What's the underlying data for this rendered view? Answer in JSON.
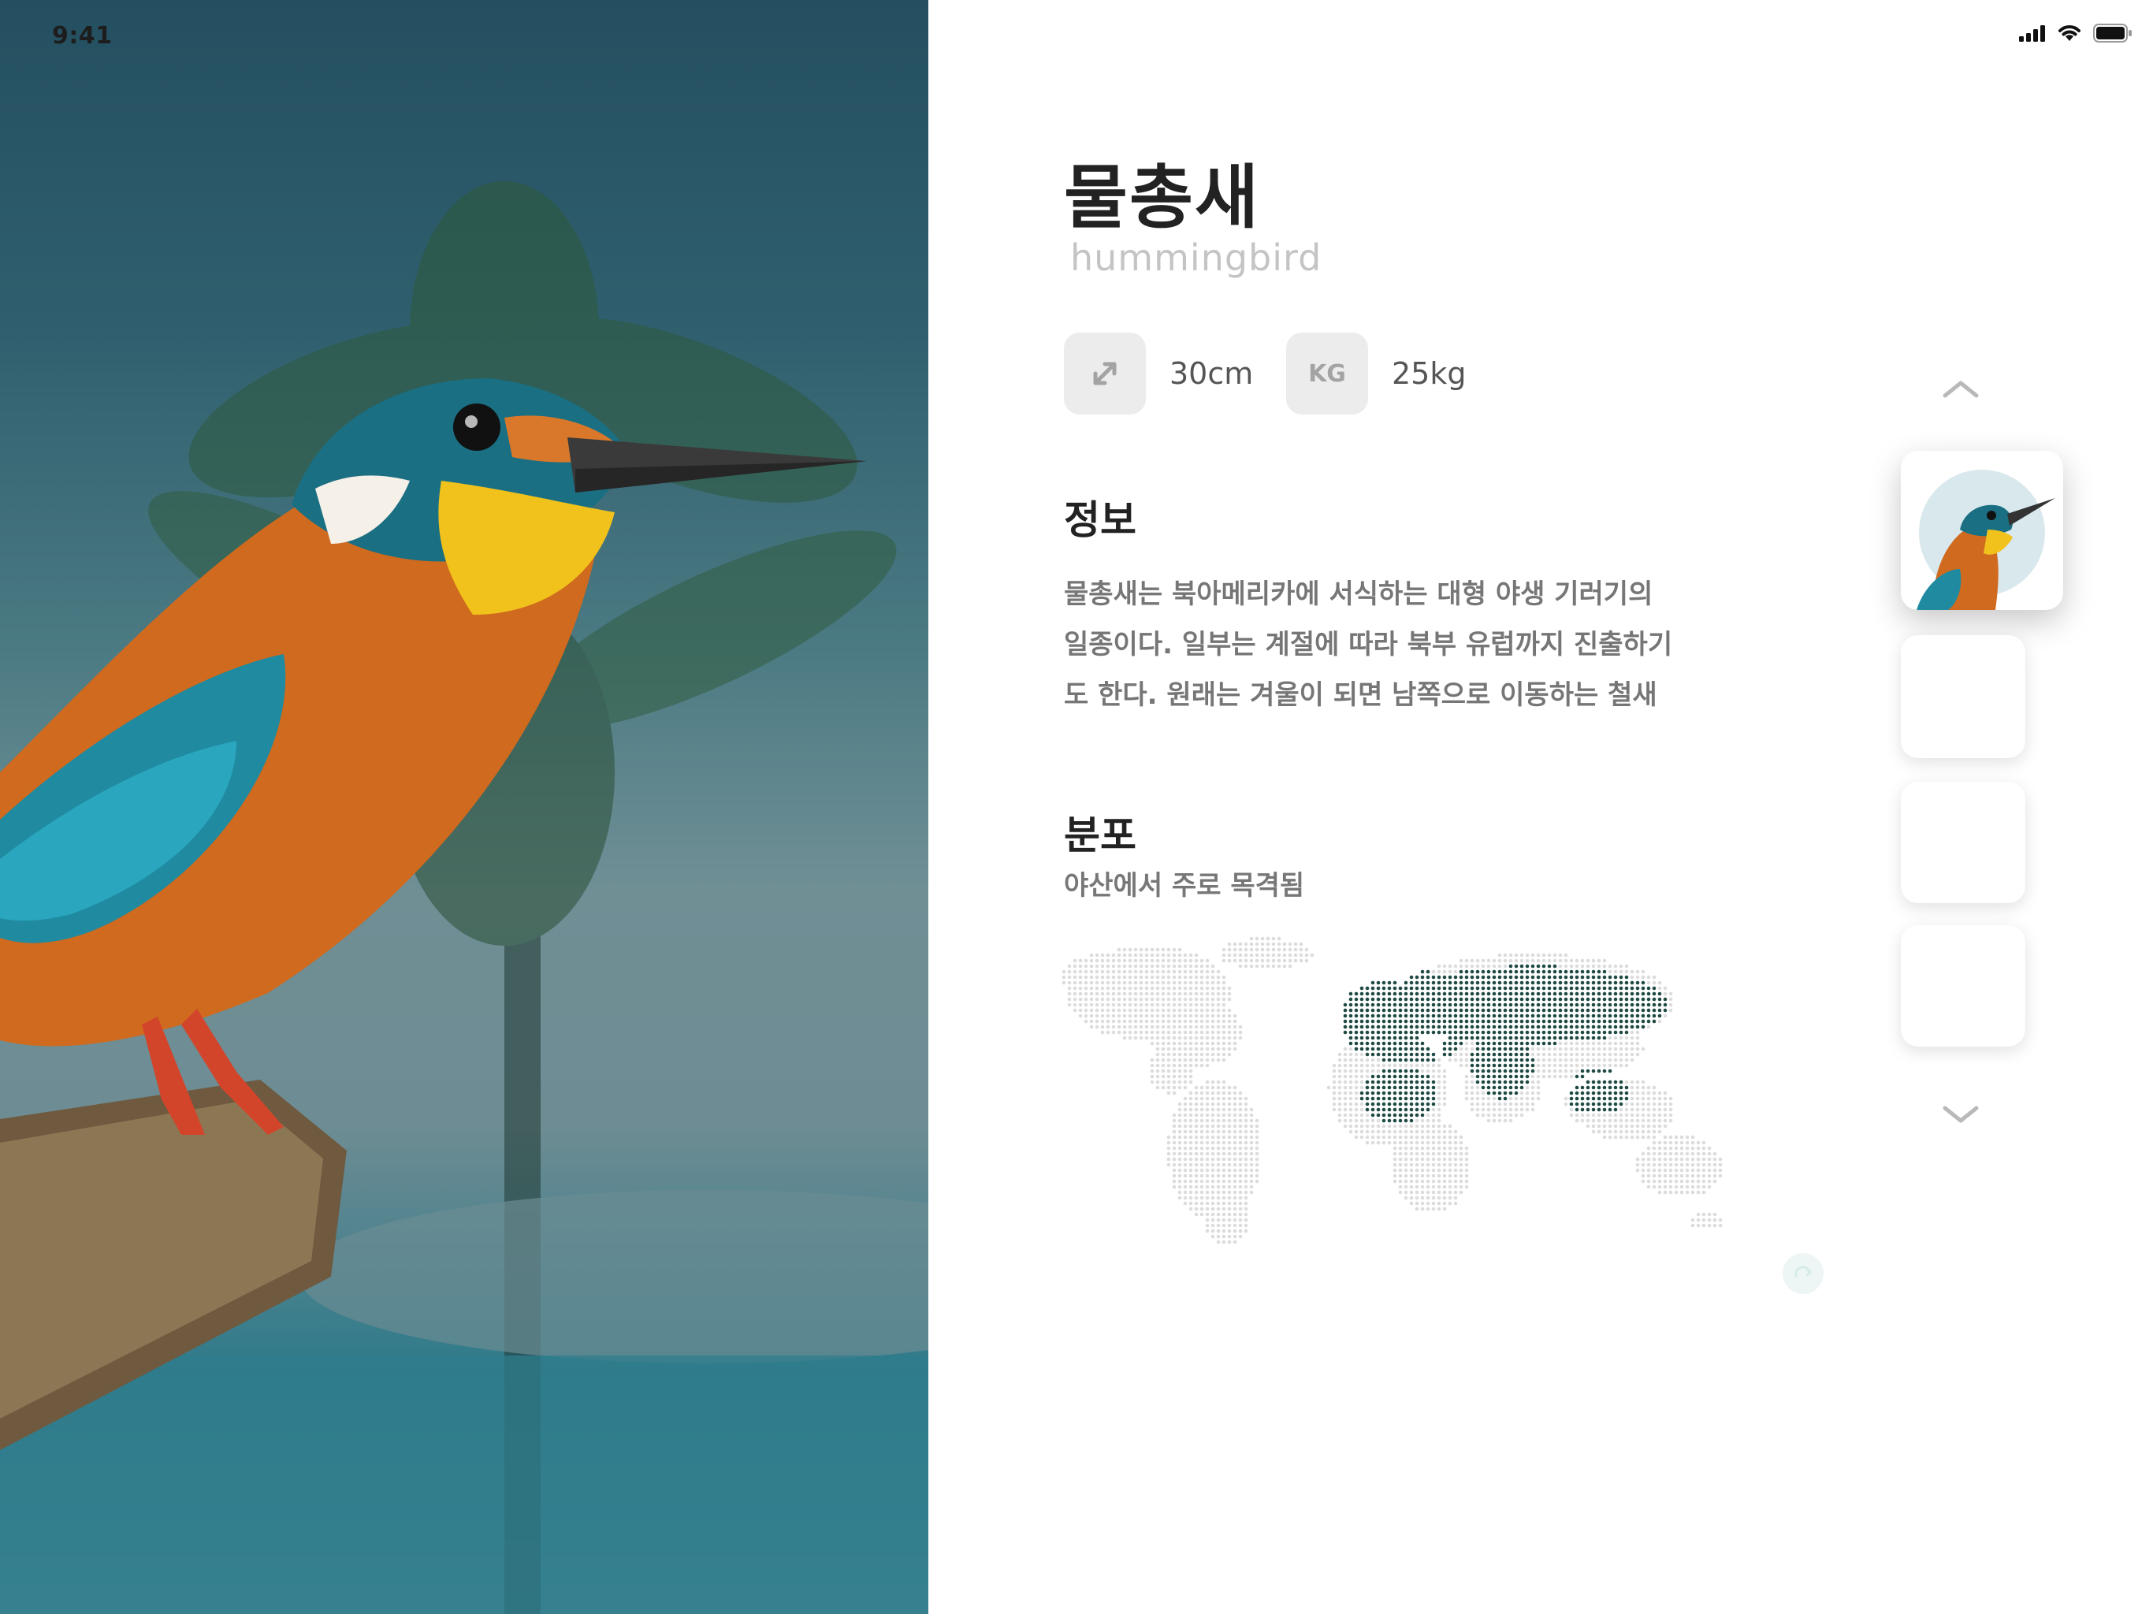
{
  "status": {
    "time": "9:41"
  },
  "species": {
    "name_kr": "물총새",
    "name_en": "hummingbird"
  },
  "stats": {
    "length_icon": "resize-diagonal-icon",
    "length": "30cm",
    "weight_icon_label": "KG",
    "weight": "25kg"
  },
  "info": {
    "heading": "정보",
    "lines": [
      "물총새는 북아메리카에 서식하는 대형 야생 기러기의",
      "일종이다. 일부는 계절에 따라 북부 유럽까지 진출하기",
      "도 한다. 원래는 겨울이 되면 남쪽으로 이동하는 철새"
    ]
  },
  "distribution": {
    "heading": "분포",
    "subtitle": "야산에서 주로 목격됨"
  },
  "colors": {
    "map_base": "#dcdcdc",
    "map_highlight": "#1f4a44",
    "map_mid": "#c9c9c9"
  }
}
